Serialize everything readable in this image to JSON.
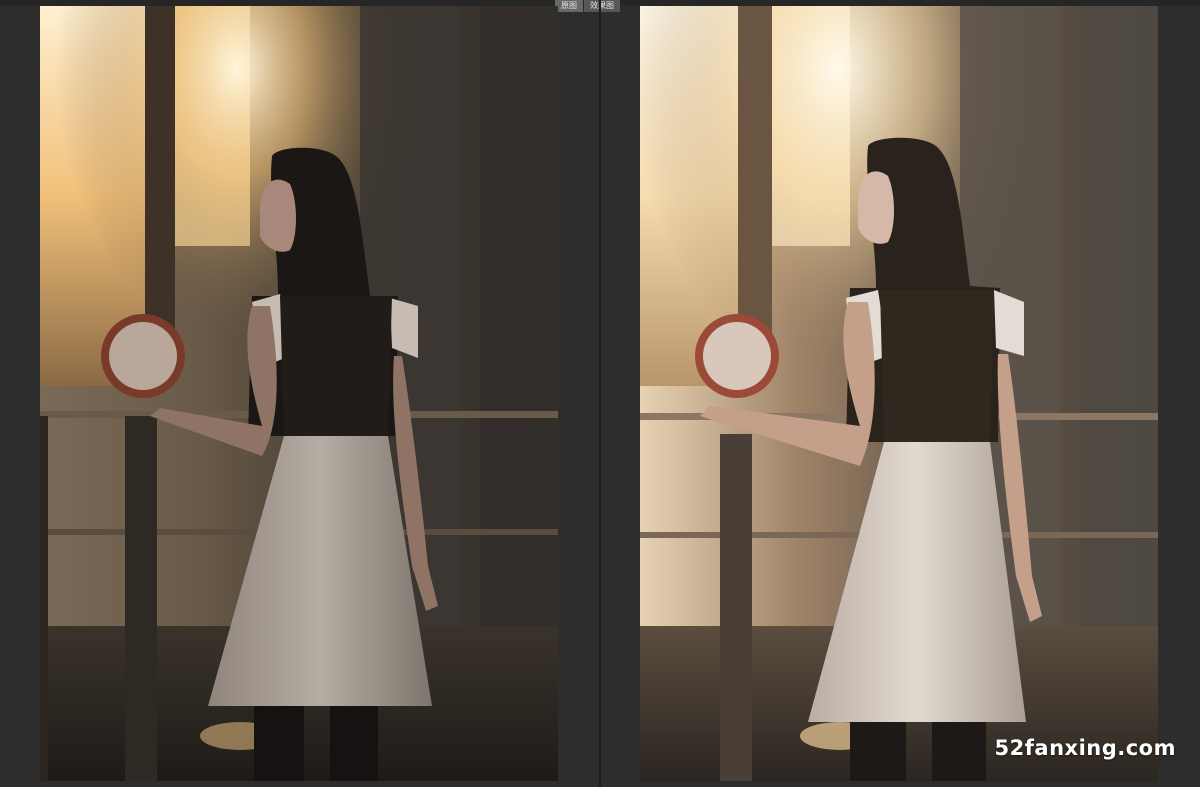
{
  "tabs": [
    {
      "label": "原图",
      "active": true
    },
    {
      "label": "效果图",
      "active": false
    }
  ],
  "watermark": "52fanxing.com",
  "colors": {
    "background": "#2d2d2d",
    "tab_bg": "#575757",
    "tab_text": "#e6e6e6",
    "divider": "#1c1c1c"
  },
  "panels": [
    {
      "name": "original",
      "tone": "dark"
    },
    {
      "name": "edited",
      "tone": "bright"
    }
  ]
}
